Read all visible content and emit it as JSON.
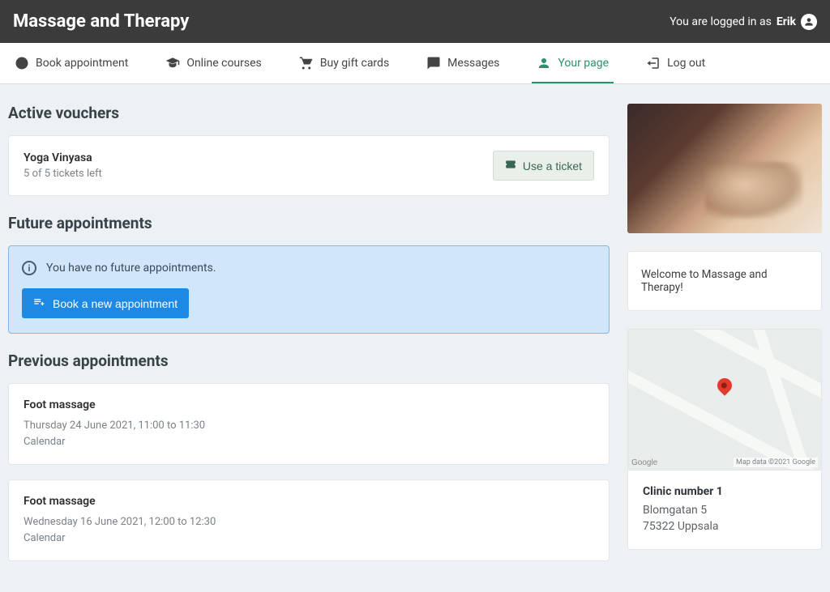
{
  "header": {
    "title": "Massage and Therapy",
    "login_prefix": "You are logged in as ",
    "login_name": "Erik"
  },
  "nav": {
    "items": [
      {
        "label": "Book appointment",
        "icon": "plus-circle-icon"
      },
      {
        "label": "Online courses",
        "icon": "graduation-cap-icon"
      },
      {
        "label": "Buy gift cards",
        "icon": "cart-icon"
      },
      {
        "label": "Messages",
        "icon": "chat-icon"
      },
      {
        "label": "Your page",
        "icon": "person-icon",
        "active": true
      },
      {
        "label": "Log out",
        "icon": "logout-icon"
      }
    ]
  },
  "sections": {
    "active_vouchers_title": "Active vouchers",
    "future_title": "Future appointments",
    "previous_title": "Previous appointments"
  },
  "voucher": {
    "title": "Yoga Vinyasa",
    "subtitle": "5 of 5 tickets left",
    "button": "Use a ticket"
  },
  "future": {
    "empty_text": "You have no future appointments.",
    "book_button": "Book a new appointment"
  },
  "previous": [
    {
      "title": "Foot massage",
      "when": "Thursday 24 June 2021, 11:00 to 11:30",
      "calendar": "Calendar"
    },
    {
      "title": "Foot massage",
      "when": "Wednesday 16 June 2021, 12:00 to 12:30",
      "calendar": "Calendar"
    }
  ],
  "sidebar": {
    "welcome": "Welcome to Massage and Therapy!",
    "map_attr": "Map data ©2021 Google",
    "map_logo": "Google",
    "clinic": {
      "name": "Clinic number 1",
      "street": "Blomgatan 5",
      "postal": "75322 Uppsala"
    }
  }
}
